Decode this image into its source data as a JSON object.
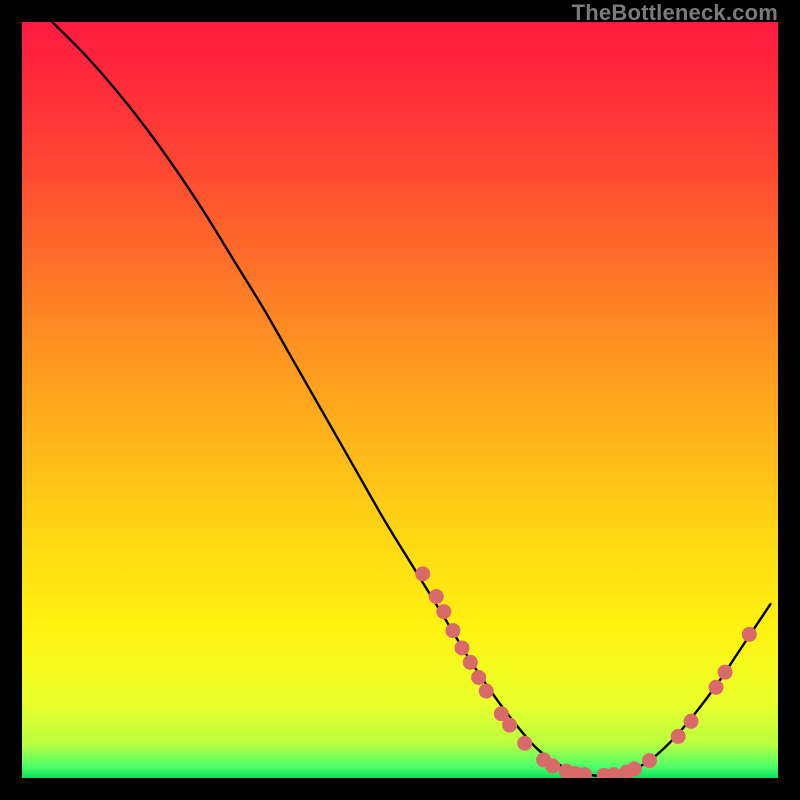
{
  "watermark": "TheBottleneck.com",
  "gradient": {
    "stops": [
      {
        "offset": 0.0,
        "color": "#ff1a3f"
      },
      {
        "offset": 0.08,
        "color": "#ff2a3a"
      },
      {
        "offset": 0.18,
        "color": "#ff4433"
      },
      {
        "offset": 0.3,
        "color": "#ff6a2a"
      },
      {
        "offset": 0.42,
        "color": "#ff8f22"
      },
      {
        "offset": 0.55,
        "color": "#ffb41a"
      },
      {
        "offset": 0.68,
        "color": "#ffd714"
      },
      {
        "offset": 0.8,
        "color": "#fff210"
      },
      {
        "offset": 0.9,
        "color": "#eaff2a"
      },
      {
        "offset": 0.955,
        "color": "#b9ff40"
      },
      {
        "offset": 0.985,
        "color": "#4dff6a"
      },
      {
        "offset": 1.0,
        "color": "#0adf5a"
      }
    ]
  },
  "chart_data": {
    "type": "line",
    "title": "",
    "xlabel": "",
    "ylabel": "",
    "xlim": [
      0,
      100
    ],
    "ylim": [
      0,
      100
    ],
    "series": [
      {
        "name": "bottleneck-curve",
        "x": [
          4,
          8,
          12,
          16,
          20,
          24,
          28,
          32,
          36,
          40,
          44,
          48,
          52,
          56,
          59,
          62,
          65,
          68,
          71,
          74,
          77,
          80,
          83,
          86,
          89,
          92,
          95,
          99
        ],
        "y": [
          100,
          96,
          91.5,
          86.5,
          81,
          75,
          68.5,
          62,
          55,
          48,
          41,
          34,
          27.5,
          21,
          16,
          11.5,
          7.5,
          4,
          1.8,
          0.6,
          0.3,
          0.8,
          2.3,
          5,
          8.5,
          12.5,
          17,
          23
        ]
      }
    ],
    "markers": {
      "name": "highlight-dots",
      "color": "#d86a6a",
      "points": [
        {
          "x": 53.0,
          "y": 27.0
        },
        {
          "x": 54.8,
          "y": 24.0
        },
        {
          "x": 55.8,
          "y": 22.0
        },
        {
          "x": 57.0,
          "y": 19.5
        },
        {
          "x": 58.2,
          "y": 17.2
        },
        {
          "x": 59.3,
          "y": 15.3
        },
        {
          "x": 60.4,
          "y": 13.3
        },
        {
          "x": 61.4,
          "y": 11.5
        },
        {
          "x": 63.4,
          "y": 8.5
        },
        {
          "x": 64.5,
          "y": 7.0
        },
        {
          "x": 66.5,
          "y": 4.6
        },
        {
          "x": 69.0,
          "y": 2.4
        },
        {
          "x": 70.2,
          "y": 1.6
        },
        {
          "x": 72.0,
          "y": 0.9
        },
        {
          "x": 73.2,
          "y": 0.6
        },
        {
          "x": 74.4,
          "y": 0.45
        },
        {
          "x": 77.0,
          "y": 0.35
        },
        {
          "x": 78.3,
          "y": 0.45
        },
        {
          "x": 80.0,
          "y": 0.8
        },
        {
          "x": 81.0,
          "y": 1.2
        },
        {
          "x": 83.0,
          "y": 2.3
        },
        {
          "x": 86.8,
          "y": 5.5
        },
        {
          "x": 88.5,
          "y": 7.5
        },
        {
          "x": 91.8,
          "y": 12.0
        },
        {
          "x": 93.0,
          "y": 14.0
        },
        {
          "x": 96.2,
          "y": 19.0
        }
      ]
    }
  }
}
